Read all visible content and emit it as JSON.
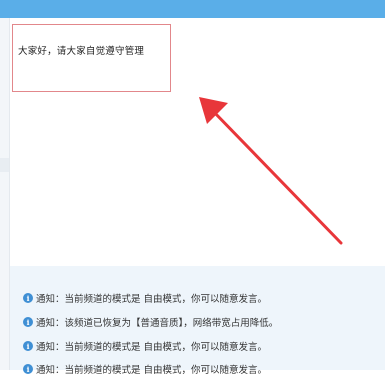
{
  "announcement": {
    "text": "大家好，请大家自觉遵守管理"
  },
  "messages": [
    {
      "icon": "info-icon",
      "prefix": "通知：",
      "body": "当前频道的模式是 自由模式，你可以随意发言。"
    },
    {
      "icon": "info-icon",
      "prefix": "通知：",
      "body": "该频道已恢复为【普通音质】，网络带宽占用降低。"
    },
    {
      "icon": "info-icon",
      "prefix": "通知：",
      "body": "当前频道的模式是 自由模式，你可以随意发言。"
    },
    {
      "icon": "info-icon",
      "prefix": "通知：",
      "body": "当前频道的模式是 自由模式，你可以随意发言。"
    }
  ],
  "colors": {
    "accent": "#5aaee8",
    "highlight_border": "#e2878b",
    "arrow": "#e8363a",
    "info_icon": "#3f8fd4",
    "messages_background": "#eef5fb"
  }
}
